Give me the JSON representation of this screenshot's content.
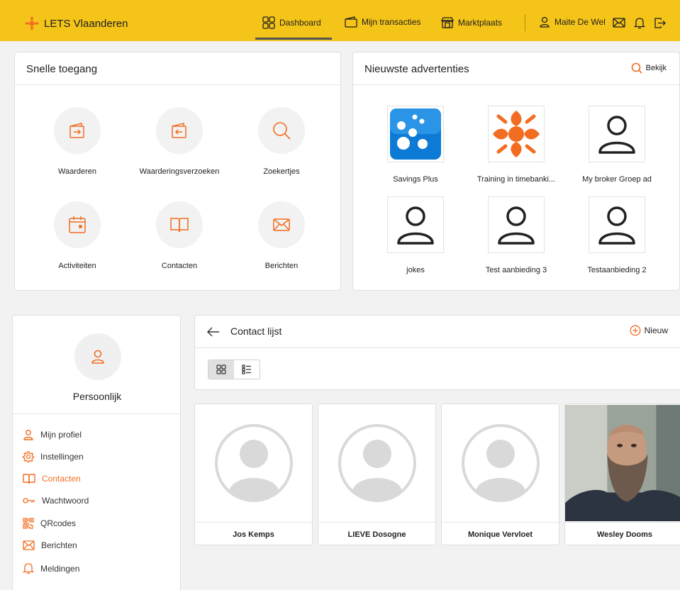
{
  "header": {
    "brand": "LETS Vlaanderen",
    "nav": [
      {
        "label": "Dashboard",
        "icon": "grid-icon",
        "active": true
      },
      {
        "label": "Mijn transacties",
        "icon": "wallet-icon"
      },
      {
        "label": "Marktplaats",
        "icon": "store-icon"
      }
    ],
    "user_name": "Maite De Wel",
    "accent": "#f4c418"
  },
  "quick_access": {
    "title": "Snelle toegang",
    "items": [
      {
        "label": "Waarderen",
        "icon": "wallet-in-icon"
      },
      {
        "label": "Waarderingsverzoeken",
        "icon": "wallet-out-icon"
      },
      {
        "label": "Zoekertjes",
        "icon": "search-icon"
      },
      {
        "label": "Activiteiten",
        "icon": "calendar-icon"
      },
      {
        "label": "Contacten",
        "icon": "book-icon"
      },
      {
        "label": "Berichten",
        "icon": "mail-icon"
      }
    ]
  },
  "latest_ads": {
    "title": "Nieuwste advertenties",
    "view_label": "Bekijk",
    "items": [
      {
        "label": "Savings Plus",
        "image": "savings-plus-logo"
      },
      {
        "label": "Training in timebanki...",
        "image": "timebanking-logo"
      },
      {
        "label": "My broker Groep ad",
        "image": "user-placeholder"
      },
      {
        "label": "jokes",
        "image": "user-placeholder"
      },
      {
        "label": "Test aanbieding 3",
        "image": "user-placeholder"
      },
      {
        "label": "Testaanbieding 2",
        "image": "user-placeholder"
      }
    ]
  },
  "sidebar": {
    "title": "Persoonlijk",
    "items": [
      {
        "label": "Mijn profiel",
        "icon": "user-icon"
      },
      {
        "label": "Instellingen",
        "icon": "gear-icon"
      },
      {
        "label": "Contacten",
        "icon": "book-icon",
        "active": true
      },
      {
        "label": "Wachtwoord",
        "icon": "key-icon"
      },
      {
        "label": "QRcodes",
        "icon": "qr-icon"
      },
      {
        "label": "Berichten",
        "icon": "mail-icon"
      },
      {
        "label": "Meldingen",
        "icon": "bell-icon"
      }
    ]
  },
  "contact_list": {
    "title": "Contact lijst",
    "new_label": "Nieuw",
    "contacts": [
      {
        "name": "Jos Kemps",
        "photo": "avatar-placeholder"
      },
      {
        "name": "LIEVE Dosogne",
        "photo": "avatar-placeholder"
      },
      {
        "name": "Monique Vervloet",
        "photo": "avatar-placeholder"
      },
      {
        "name": "Wesley Dooms",
        "photo": "person-photo"
      }
    ]
  },
  "colors": {
    "orange": "#f26d21",
    "grey_icon": "#d9d9d9"
  }
}
